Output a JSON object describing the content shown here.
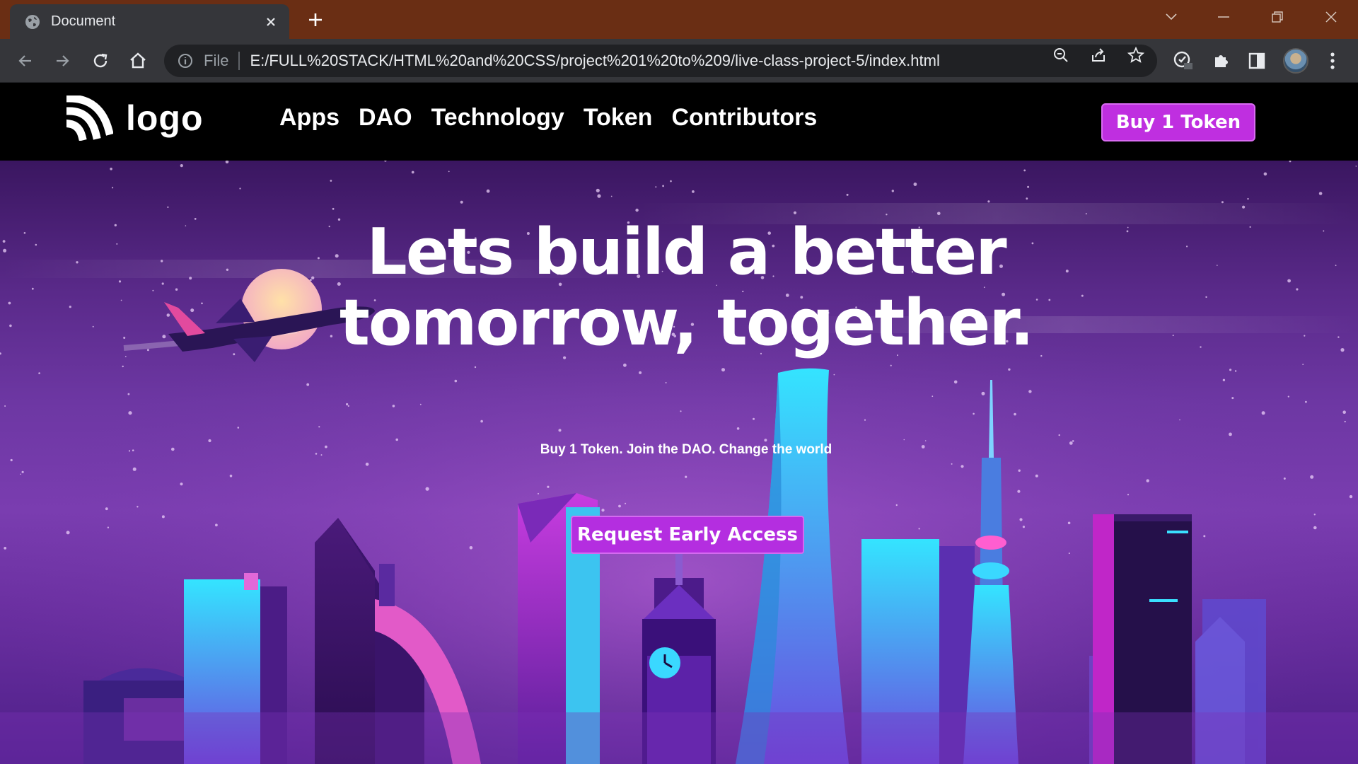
{
  "browser": {
    "tab_title": "Document",
    "address_prefix": "File",
    "url": "E:/FULL%20STACK/HTML%20and%20CSS/project%201%20to%209/live-class-project-5/index.html"
  },
  "site": {
    "logo_text": "logo",
    "nav": [
      "Apps",
      "DAO",
      "Technology",
      "Token",
      "Contributors"
    ],
    "buy_button": "Buy 1 Token"
  },
  "hero": {
    "headline_line1": "Lets build a better",
    "headline_line2": "tomorrow, together.",
    "subheadline": "Buy 1 Token. Join the DAO. Change the world",
    "cta": "Request Early Access"
  },
  "colors": {
    "tab_strip": "#6a2e14",
    "button_purple": "#bf2fe0",
    "hero_purple": "#6d37a3"
  }
}
